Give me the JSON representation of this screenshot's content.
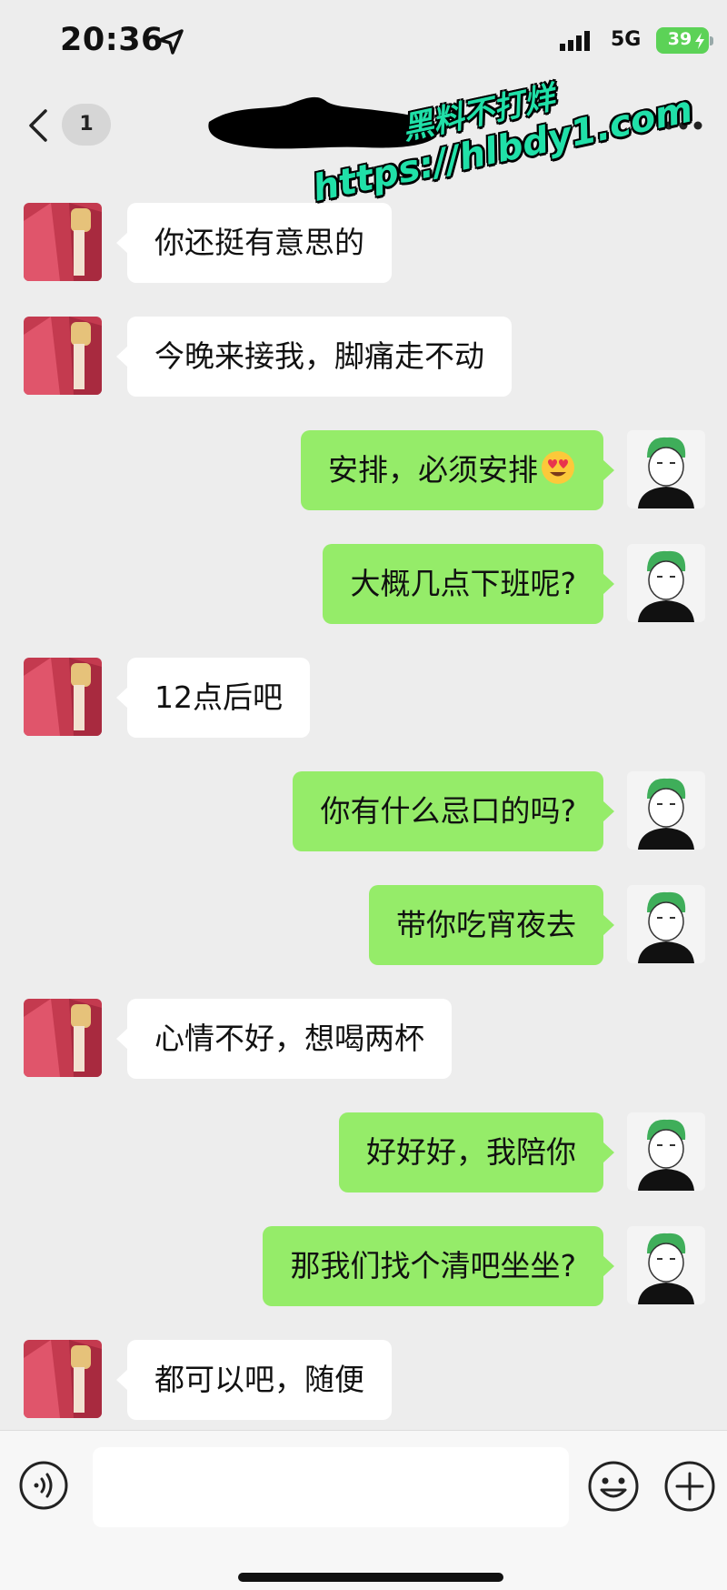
{
  "status_bar": {
    "time": "20:36",
    "network": "5G",
    "battery": "39"
  },
  "nav": {
    "unread_count": "1"
  },
  "watermark": {
    "line1": "黑料不打烊",
    "line2": "https://hlbdy1.com"
  },
  "messages": [
    {
      "side": "left",
      "text": "你还挺有意思的"
    },
    {
      "side": "left",
      "text": "今晚来接我，脚痛走不动"
    },
    {
      "side": "right",
      "text": "安排，必须安排",
      "emoji": "heart-eyes-emoji"
    },
    {
      "side": "right",
      "text": "大概几点下班呢?"
    },
    {
      "side": "left",
      "text": "12点后吧"
    },
    {
      "side": "right",
      "text": "你有什么忌口的吗?"
    },
    {
      "side": "right",
      "text": "带你吃宵夜去"
    },
    {
      "side": "left",
      "text": "心情不好，想喝两杯"
    },
    {
      "side": "right",
      "text": "好好好，我陪你"
    },
    {
      "side": "right",
      "text": "那我们找个清吧坐坐?"
    },
    {
      "side": "left",
      "text": "都可以吧，随便"
    }
  ],
  "input": {
    "placeholder": ""
  },
  "colors": {
    "background": "#ededed",
    "sent_bubble": "#95ec69",
    "received_bubble": "#ffffff",
    "watermark": "#20e0a8",
    "battery": "#5cd257"
  }
}
